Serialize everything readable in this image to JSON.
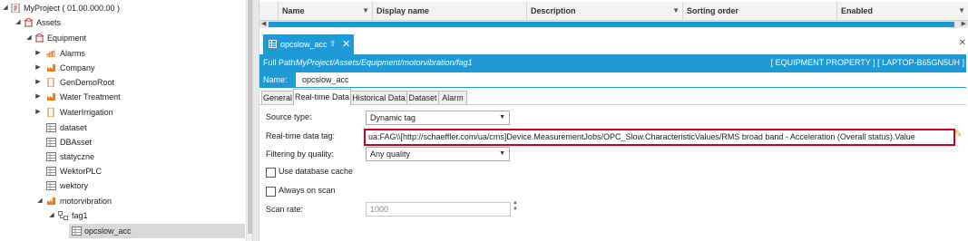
{
  "tree": {
    "project": "MyProject ( 01.00.000.00 )",
    "assets": "Assets",
    "equipment": "Equipment",
    "alarms": "Alarms",
    "company": "Company",
    "gendemoroot": "GenDemoRoot",
    "water_treatment": "Water Treatment",
    "waterirrigation": "WaterIrrigation",
    "dataset": "dataset",
    "dbasset": "DBAsset",
    "statyczne": "statyczne",
    "wektorplc": "WektorPLC",
    "wektory": "wektory",
    "motorvibration": "motorvibration",
    "fag1": "fag1",
    "opcslow_acc": "opcslow_acc"
  },
  "grid": {
    "columns": [
      "Name",
      "Display name",
      "Description",
      "Sorting order",
      "Enabled"
    ]
  },
  "document": {
    "tab_title": "opcslow_acc",
    "full_path_label": "Full Path:",
    "full_path": "MyProject/Assets/Equipment/motorvibration/fag1",
    "right_info": "[ EQUIPMENT PROPERTY ] [ LAPTOP-B65GN5UH ]",
    "name_label": "Name:",
    "name_value": "opcslow_acc"
  },
  "tabs": [
    "General",
    "Real-time Data",
    "Historical Data",
    "Dataset",
    "Alarm"
  ],
  "form": {
    "source_type_label": "Source type:",
    "source_type_value": "Dynamic tag",
    "realtime_tag_label": "Real-time data tag:",
    "realtime_tag_value": "ua:FAG\\\\[http://schaeffler.com/ua/cms]Device.MeasurementJobs/OPC_Slow.CharacteristicValues/RMS broad band - Acceleration (Overall status).Value",
    "filtering_label": "Filtering by quality:",
    "filtering_value": "Any quality",
    "use_db_cache_label": "Use database cache",
    "always_on_scan_label": "Always on scan",
    "scan_rate_label": "Scan rate:",
    "scan_rate_value": "1000"
  },
  "colors": {
    "accent": "#1f9ad7",
    "highlight": "#d0021b"
  }
}
